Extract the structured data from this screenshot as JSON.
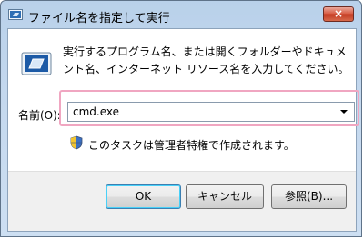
{
  "window": {
    "title": "ファイル名を指定して実行",
    "close_glyph": "×"
  },
  "dialog": {
    "description": "実行するプログラム名、または開くフォルダーやドキュメント名、インターネット リソース名を入力してください。",
    "name_label": "名前(O):",
    "name_value": "cmd.exe",
    "admin_notice": "このタスクは管理者特権で作成されます。"
  },
  "buttons": {
    "ok": "OK",
    "cancel": "キャンセル",
    "browse": "参照(B)..."
  },
  "icons": {
    "title": "run-icon",
    "dialog": "run-icon",
    "shield": "uac-shield-icon"
  },
  "colors": {
    "highlight_border": "#f0a6c1",
    "close_button": "#c23a22",
    "titlebar": "#b9d1ea"
  }
}
